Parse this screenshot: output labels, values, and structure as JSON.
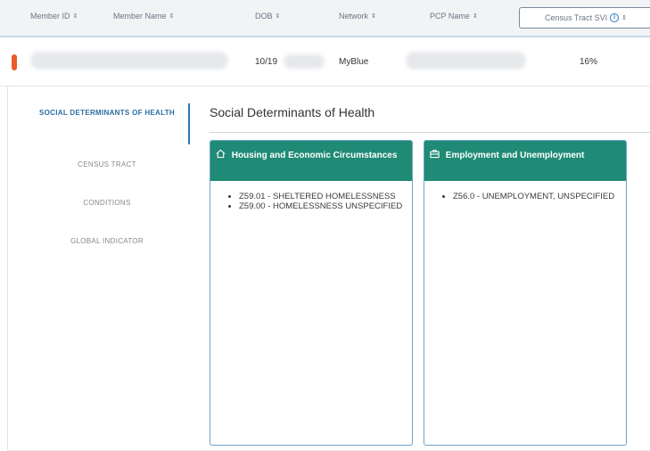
{
  "table": {
    "headers": [
      {
        "label": "Member ID"
      },
      {
        "label": "Member Name"
      },
      {
        "label": "DOB"
      },
      {
        "label": "Network"
      },
      {
        "label": "PCP Name"
      },
      {
        "label": "Census Tract SVI"
      }
    ],
    "sort_glyph": "⇕",
    "row": {
      "dob": "10/19",
      "network": "MyBlue",
      "svi": "16%"
    }
  },
  "nav": {
    "items": [
      {
        "label": "SOCIAL DETERMINANTS OF HEALTH"
      },
      {
        "label": "CENSUS TRACT"
      },
      {
        "label": "CONDITIONS"
      },
      {
        "label": "GLOBAL INDICATOR"
      }
    ]
  },
  "section": {
    "title": "Social Determinants of Health"
  },
  "cards": [
    {
      "title": "Housing and Economic Circumstances",
      "icon": "home-icon",
      "items": [
        "Z59.01 - SHELTERED HOMELESSNESS",
        "Z59.00 - HOMELESSNESS UNSPECIFIED"
      ]
    },
    {
      "title": "Employment and Unemployment",
      "icon": "briefcase-icon",
      "items": [
        "Z56.0 - UNEMPLOYMENT, UNSPECIFIED"
      ]
    }
  ],
  "colors": {
    "card_header": "#1f8a75",
    "accent": "#2a79b9",
    "flag": "#ec5a2a"
  }
}
